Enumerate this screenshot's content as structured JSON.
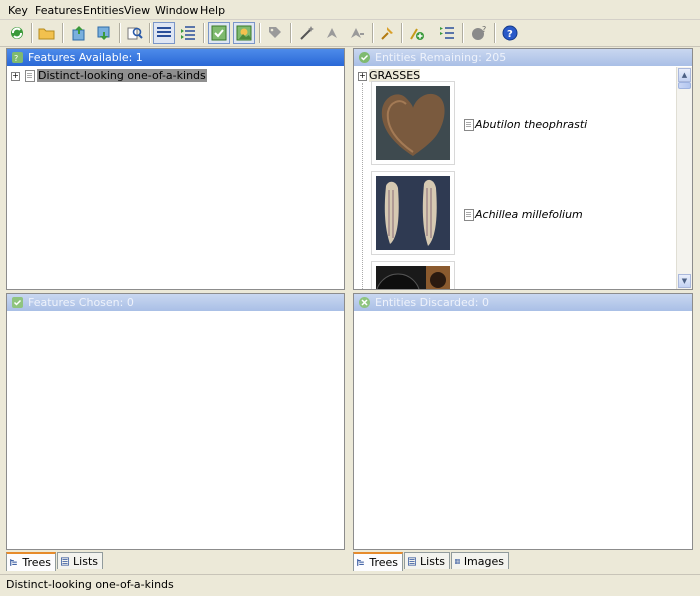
{
  "menu": {
    "items": [
      "Key",
      "Features",
      "Entities",
      "View",
      "Window",
      "Help"
    ]
  },
  "toolbar": {
    "icons": [
      "refresh-icon",
      "open-folder-icon",
      "export-icon",
      "import-icon",
      "find-icon",
      "list-view-icon",
      "indent-list-icon",
      "check-image-icon",
      "color-image-icon",
      "tag-icon",
      "magic-wand-icon",
      "arrow-tool-icon",
      "arrow-tool-2-icon",
      "pin-icon",
      "add-feature-icon",
      "numbered-list-icon",
      "help-query-icon",
      "help-icon"
    ]
  },
  "panels": {
    "features_available": {
      "title": "Features Available: 1",
      "items": [
        {
          "label": "Distinct-looking one-of-a-kinds"
        }
      ]
    },
    "features_chosen": {
      "title": "Features Chosen: 0"
    },
    "entities_remaining": {
      "title": "Entities Remaining: 205",
      "group": "GRASSES",
      "entities": [
        {
          "name": "Abutilon theophrasti"
        },
        {
          "name": "Achillea millefolium"
        }
      ]
    },
    "entities_discarded": {
      "title": "Entities Discarded: 0"
    }
  },
  "tabs": {
    "left": [
      "Trees",
      "Lists"
    ],
    "right": [
      "Trees",
      "Lists",
      "Images"
    ]
  },
  "status": {
    "text": "Distinct-looking one-of-a-kinds"
  },
  "colors": {
    "header_active": "#2a68d6",
    "header_inactive": "#a9bfe6",
    "tab_accent": "#e68b2c"
  }
}
